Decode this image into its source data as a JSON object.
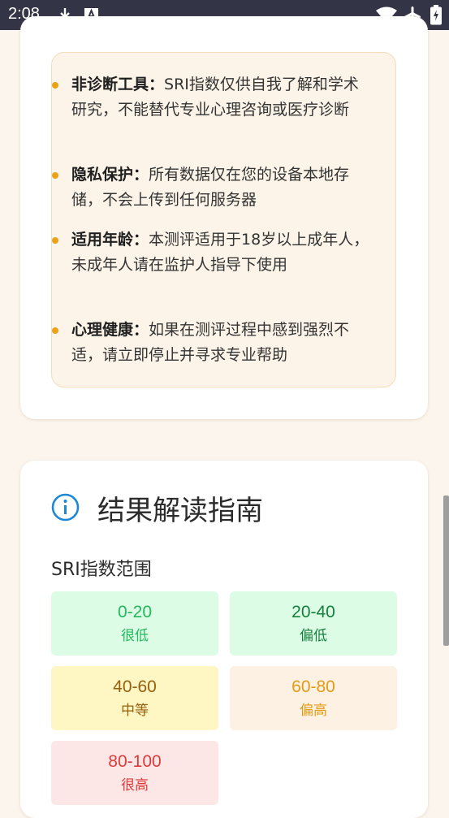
{
  "status_bar": {
    "time": "2:08",
    "icons": [
      "download-icon",
      "font-a-icon",
      "wifi-icon",
      "airplane-icon",
      "battery-icon"
    ]
  },
  "notices": [
    {
      "title": "非诊断工具",
      "text": "SRI指数仅供自我了解和学术研究，不能替代专业心理咨询或医疗诊断"
    },
    {
      "title": "隐私保护",
      "text": "所有数据仅在您的设备本地存储，不会上传到任何服务器"
    },
    {
      "title": "适用年龄",
      "text": "本测评适用于18岁以上成年人，未成年人请在监护人指导下使用"
    },
    {
      "title": "心理健康",
      "text": "如果在测评过程中感到强烈不适，请立即停止并寻求专业帮助"
    }
  ],
  "guide": {
    "title": "结果解读指南",
    "range_title": "SRI指数范围",
    "ranges": [
      {
        "range": "0-20",
        "level": "很低",
        "bg": "#dcfce6",
        "fg": "#22b85c"
      },
      {
        "range": "20-40",
        "level": "偏低",
        "bg": "#dcfce6",
        "fg": "#15803d"
      },
      {
        "range": "40-60",
        "level": "中等",
        "bg": "#fef6c3",
        "fg": "#96600e"
      },
      {
        "range": "60-80",
        "level": "偏高",
        "bg": "#fdf1e4",
        "fg": "#e59a14"
      },
      {
        "range": "80-100",
        "level": "很高",
        "bg": "#fde6e6",
        "fg": "#dd3b3b"
      }
    ]
  },
  "colors": {
    "accent": "#eba21a",
    "info_blue": "#1e88d8"
  }
}
